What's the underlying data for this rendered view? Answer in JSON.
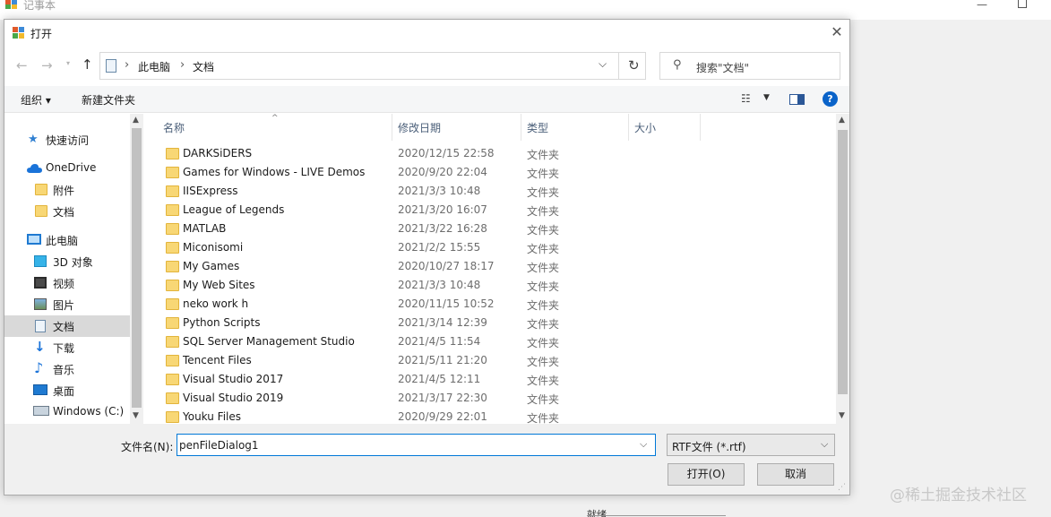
{
  "background_window": {
    "title": "记事本",
    "minimize_glyph": "—",
    "status_text": "就绪"
  },
  "watermark": "@稀土掘金技术社区",
  "dialog": {
    "title": "打开",
    "close_glyph": "✕"
  },
  "navigation": {
    "back_glyph": "←",
    "forward_glyph": "→",
    "recent_glyph": "▾",
    "up_glyph": "↑"
  },
  "address": {
    "separator": "›",
    "crumbs": [
      "此电脑",
      "文档"
    ],
    "dropdown_glyph": "⌵",
    "refresh_glyph": "↻"
  },
  "search": {
    "icon_glyph": "⚲",
    "placeholder": "搜索\"文档\""
  },
  "toolbar": {
    "organize_label": "组织 ▾",
    "new_folder_label": "新建文件夹",
    "view_icon_glyph": "☷",
    "view_arrow_glyph": "▼",
    "help_glyph": "?"
  },
  "nav_pane": {
    "items": [
      {
        "label": "快速访问",
        "icon": "star-icon"
      },
      {
        "label": "OneDrive",
        "icon": "cloud-icon"
      },
      {
        "label": "附件",
        "icon": "folder-icon"
      },
      {
        "label": "文档",
        "icon": "folder-icon"
      },
      {
        "label": "此电脑",
        "icon": "computer-icon"
      },
      {
        "label": "3D 对象",
        "icon": "cube-icon"
      },
      {
        "label": "视频",
        "icon": "video-icon"
      },
      {
        "label": "图片",
        "icon": "picture-icon"
      },
      {
        "label": "文档",
        "icon": "document-icon"
      },
      {
        "label": "下载",
        "icon": "download-icon"
      },
      {
        "label": "音乐",
        "icon": "music-icon"
      },
      {
        "label": "桌面",
        "icon": "desktop-icon"
      },
      {
        "label": "Windows (C:)",
        "icon": "drive-icon"
      }
    ],
    "selected_index": 8,
    "scroll_up_glyph": "▲",
    "scroll_down_glyph": "▼"
  },
  "file_list": {
    "sort_glyph": "^",
    "columns": [
      "名称",
      "修改日期",
      "类型",
      "大小"
    ],
    "rows": [
      {
        "name": "DARKSiDERS",
        "date": "2020/12/15 22:58",
        "type": "文件夹"
      },
      {
        "name": "Games for Windows - LIVE Demos",
        "date": "2020/9/20 22:04",
        "type": "文件夹"
      },
      {
        "name": "IISExpress",
        "date": "2021/3/3 10:48",
        "type": "文件夹"
      },
      {
        "name": "League of Legends",
        "date": "2021/3/20 16:07",
        "type": "文件夹"
      },
      {
        "name": "MATLAB",
        "date": "2021/3/22 16:28",
        "type": "文件夹"
      },
      {
        "name": "Miconisomi",
        "date": "2021/2/2 15:55",
        "type": "文件夹"
      },
      {
        "name": "My Games",
        "date": "2020/10/27 18:17",
        "type": "文件夹"
      },
      {
        "name": "My Web Sites",
        "date": "2021/3/3 10:48",
        "type": "文件夹"
      },
      {
        "name": "neko work h",
        "date": "2020/11/15 10:52",
        "type": "文件夹"
      },
      {
        "name": "Python Scripts",
        "date": "2021/3/14 12:39",
        "type": "文件夹"
      },
      {
        "name": "SQL Server Management Studio",
        "date": "2021/4/5 11:54",
        "type": "文件夹"
      },
      {
        "name": "Tencent Files",
        "date": "2021/5/11 21:20",
        "type": "文件夹"
      },
      {
        "name": "Visual Studio 2017",
        "date": "2021/4/5 12:11",
        "type": "文件夹"
      },
      {
        "name": "Visual Studio 2019",
        "date": "2021/3/17 22:30",
        "type": "文件夹"
      },
      {
        "name": "Youku Files",
        "date": "2020/9/29 22:01",
        "type": "文件夹"
      }
    ],
    "scroll_up_glyph": "▲",
    "scroll_down_glyph": "▼"
  },
  "bottom": {
    "filename_label": "文件名(N):",
    "filename_value": "penFileDialog1",
    "filename_dropdown_glyph": "⌵",
    "filetype_value": "RTF文件 (*.rtf)",
    "filetype_arrow_glyph": "⌵",
    "open_label": "打开(O)",
    "cancel_label": "取消",
    "grip_glyph": "⋰"
  },
  "colors": {
    "accent": "#0078d7",
    "folder": "#f8d775",
    "selected_bg": "#d9d9d9",
    "help_blue": "#0a63c9"
  }
}
